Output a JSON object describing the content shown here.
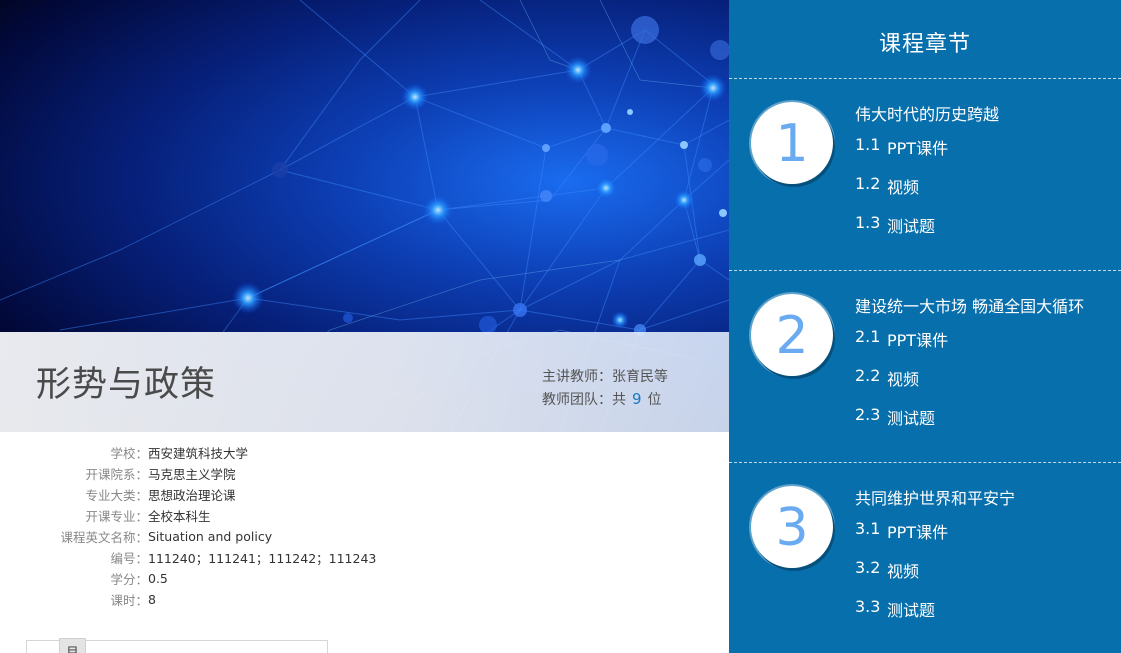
{
  "course": {
    "title": "形势与政策",
    "teacher_label": "主讲教师：张育民等",
    "team_prefix": "教师团队：共",
    "team_count": "9",
    "team_suffix": "位"
  },
  "info": [
    {
      "label": "学校：",
      "value": "西安建筑科技大学"
    },
    {
      "label": "开课院系：",
      "value": "马克思主义学院"
    },
    {
      "label": "专业大类：",
      "value": "思想政治理论课"
    },
    {
      "label": "开课专业：",
      "value": "全校本科生"
    },
    {
      "label": "课程英文名称：",
      "value": "Situation and policy"
    },
    {
      "label": "编号：",
      "value": "111240；111241；111242；111243"
    },
    {
      "label": "学分：",
      "value": "0.5"
    },
    {
      "label": "课时：",
      "value": "8"
    }
  ],
  "bottom_tab": "目",
  "panel": {
    "title": "课程章节",
    "chapters": [
      {
        "number": "1",
        "name": "伟大时代的历史跨越",
        "items": [
          {
            "no": "1.1",
            "label": "PPT课件"
          },
          {
            "no": "1.2",
            "label": "视频"
          },
          {
            "no": "1.3",
            "label": "测试题"
          }
        ]
      },
      {
        "number": "2",
        "name": "建设统一大市场 畅通全国大循环",
        "items": [
          {
            "no": "2.1",
            "label": "PPT课件"
          },
          {
            "no": "2.2",
            "label": "视频"
          },
          {
            "no": "2.3",
            "label": "测试题"
          }
        ]
      },
      {
        "number": "3",
        "name": "共同维护世界和平安宁",
        "items": [
          {
            "no": "3.1",
            "label": "PPT课件"
          },
          {
            "no": "3.2",
            "label": "视频"
          },
          {
            "no": "3.3",
            "label": "测试题"
          }
        ]
      }
    ]
  },
  "colors": {
    "panel_bg": "#086fad",
    "accent_number": "#6aaaf0",
    "team_count": "#1a7ac0"
  }
}
